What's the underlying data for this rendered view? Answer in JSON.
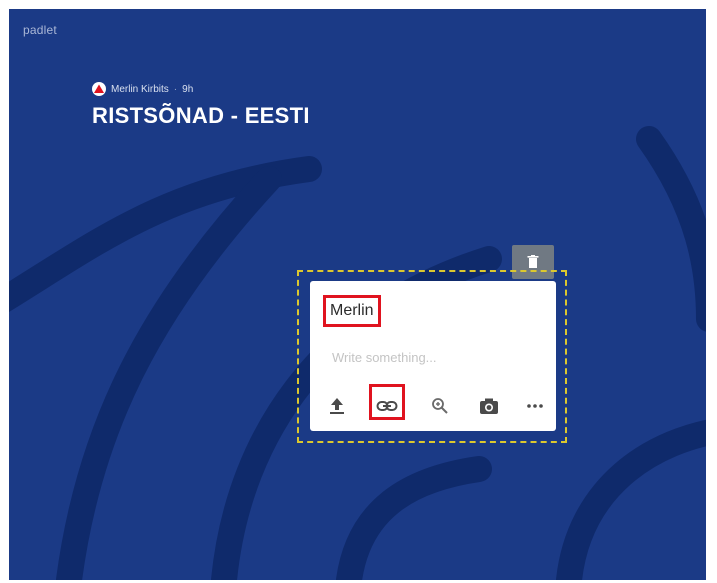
{
  "app": {
    "logo": "padlet"
  },
  "board": {
    "author": "Merlin Kirbits",
    "separator": "·",
    "time": "9h",
    "title": "RISTSÕNAD - EESTI"
  },
  "post": {
    "name": "Merlin",
    "placeholder": "Write something..."
  },
  "toolbar": {
    "items": [
      "upload-icon",
      "link-icon",
      "search-icon",
      "camera-icon",
      "more-icon"
    ]
  },
  "colors": {
    "background": "#1b3a86",
    "arc": "#0f2a6b",
    "highlight": "#e0131f",
    "outline": "#dcc82e",
    "delete_bg": "#707983"
  }
}
